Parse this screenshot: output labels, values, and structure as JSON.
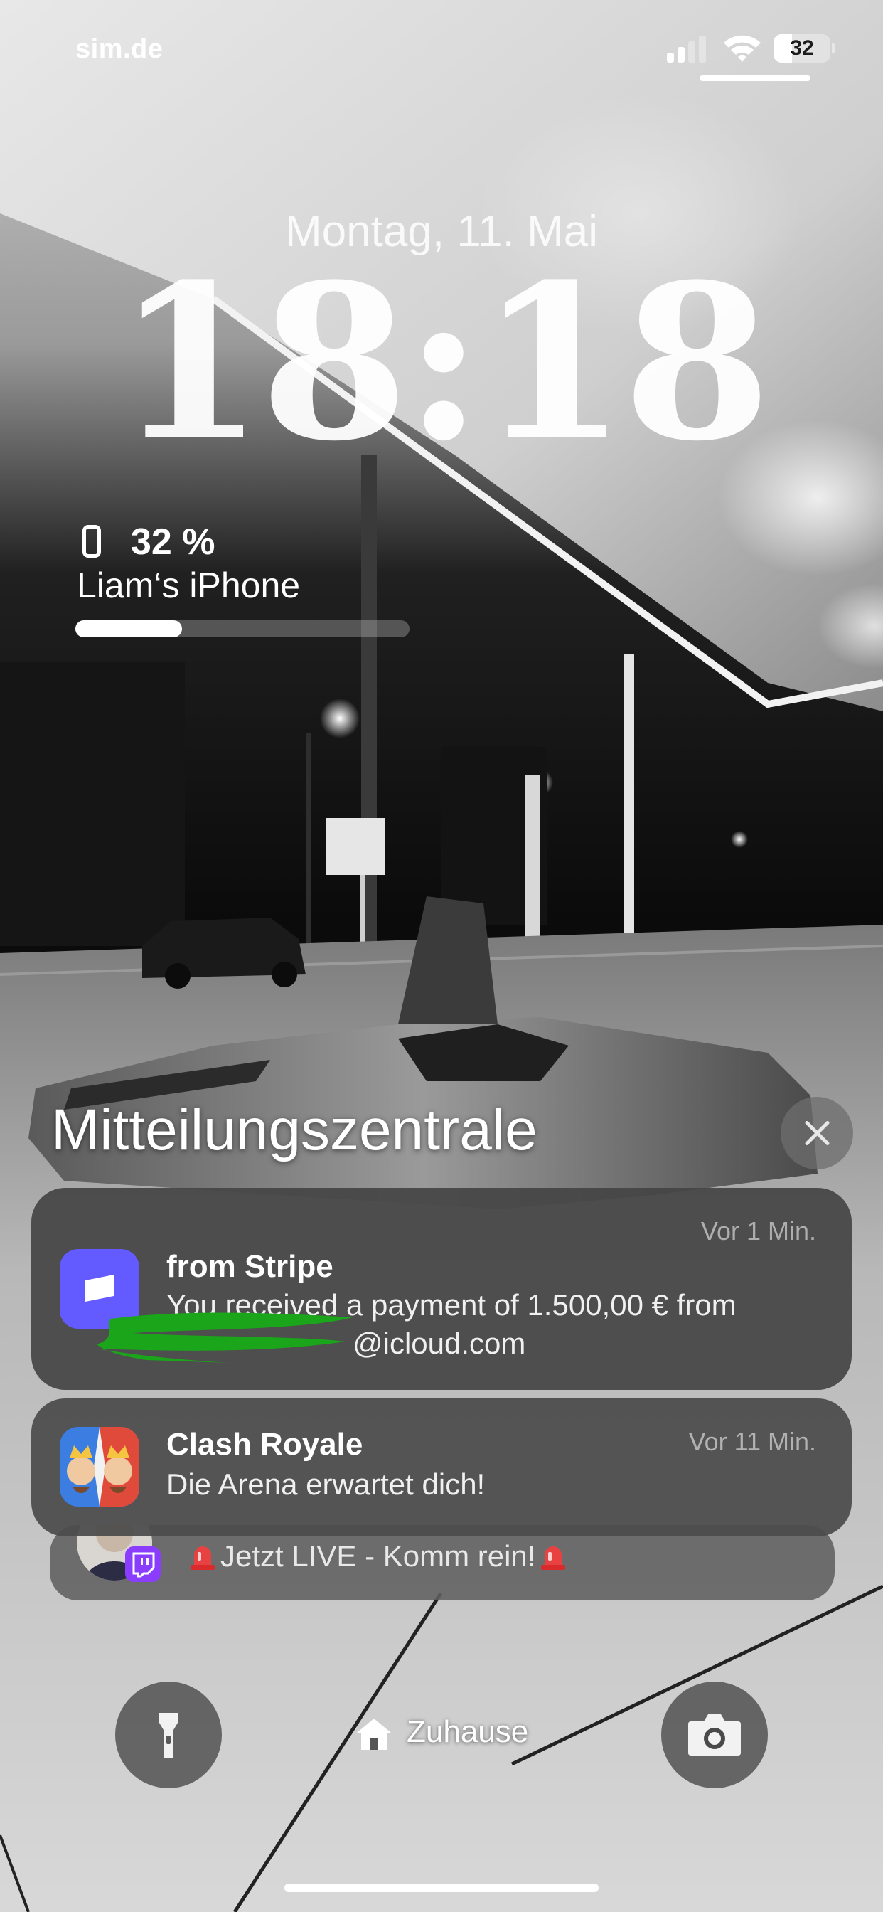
{
  "status_bar": {
    "carrier": "sim.de",
    "battery_level": "32",
    "signal_bars_active": 2,
    "signal_bars_total": 4
  },
  "lock_screen": {
    "date": "Montag, 11. Mai",
    "time": "18:18"
  },
  "battery_widget": {
    "percent_label": "32 %",
    "percent": 32,
    "device_name": "Liam‘s iPhone"
  },
  "notification_center": {
    "title": "Mitteilungszentrale",
    "notifications": [
      {
        "app_icon": "stripe-icon",
        "title": "from Stripe",
        "time": "Vor 1 Min.",
        "body_line1": "You received a payment of 1.500,00 € from",
        "body_line2": "@icloud.com",
        "accent": "#635bff"
      },
      {
        "app_icon": "clash-royale-icon",
        "title": "Clash Royale",
        "time": "Vor 11 Min.",
        "body": "Die Arena erwartet dich!"
      }
    ],
    "stacked": {
      "app_icon": "twitch-icon",
      "text": "Jetzt LIVE - Komm rein!",
      "accent": "#8a3cff"
    }
  },
  "controls": {
    "flashlight_icon": "flashlight-icon",
    "camera_icon": "camera-icon",
    "focus_icon": "home-icon",
    "focus_label": "Zuhause"
  },
  "colors": {
    "redaction": "#1aa51a"
  }
}
